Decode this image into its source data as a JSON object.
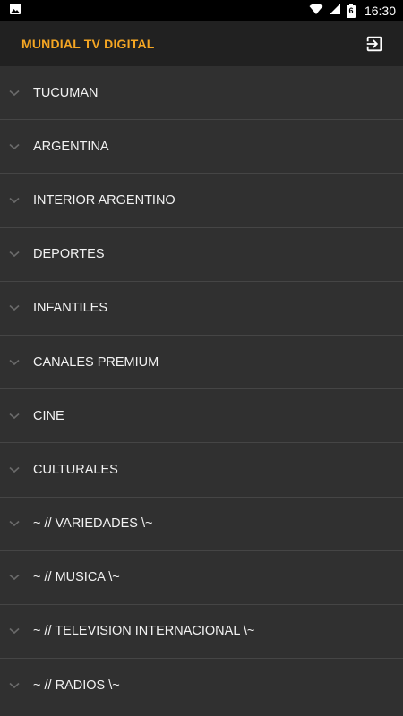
{
  "status_bar": {
    "time": "16:30",
    "battery_level": "6",
    "icons": [
      "image-icon",
      "wifi-icon",
      "signal-icon",
      "battery-icon"
    ]
  },
  "toolbar": {
    "title": "MUNDIAL TV DIGITAL",
    "exit_icon": "exit-icon",
    "accent_color": "#F5A623"
  },
  "categories": [
    {
      "label": "TUCUMAN"
    },
    {
      "label": "ARGENTINA"
    },
    {
      "label": "INTERIOR ARGENTINO"
    },
    {
      "label": "DEPORTES"
    },
    {
      "label": "INFANTILES"
    },
    {
      "label": "CANALES PREMIUM"
    },
    {
      "label": "CINE"
    },
    {
      "label": "CULTURALES"
    },
    {
      "label": "~ // VARIEDADES \\~"
    },
    {
      "label": "~ // MUSICA \\~"
    },
    {
      "label": "~ // TELEVISION INTERNACIONAL \\~"
    },
    {
      "label": "~ // RADIOS \\~"
    }
  ]
}
